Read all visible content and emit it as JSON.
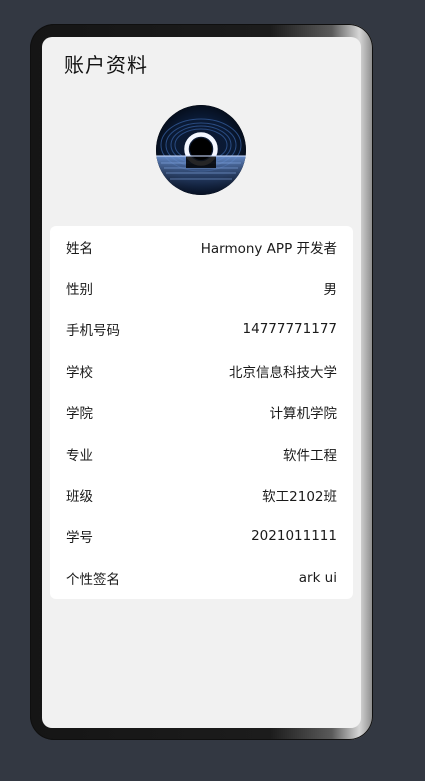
{
  "header": {
    "title": "账户资料"
  },
  "avatar": {
    "icon": "avatar-image"
  },
  "profile": {
    "rows": [
      {
        "label": "姓名",
        "value": "Harmony APP 开发者"
      },
      {
        "label": "性别",
        "value": "男"
      },
      {
        "label": "手机号码",
        "value": "14777771177"
      },
      {
        "label": "学校",
        "value": "北京信息科技大学"
      },
      {
        "label": "学院",
        "value": "计算机学院"
      },
      {
        "label": "专业",
        "value": "软件工程"
      },
      {
        "label": "班级",
        "value": "软工2102班"
      },
      {
        "label": "学号",
        "value": "2021011111"
      },
      {
        "label": "个性签名",
        "value": "ark ui"
      }
    ]
  }
}
